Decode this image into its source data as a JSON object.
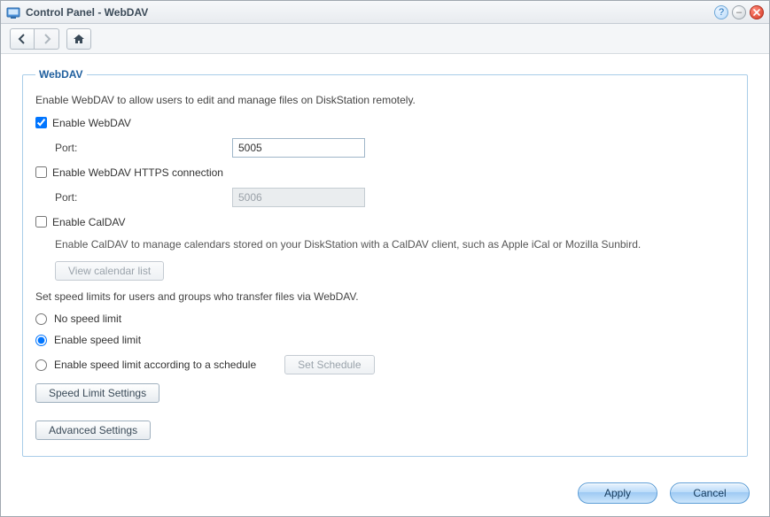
{
  "window": {
    "title": "Control Panel - WebDAV"
  },
  "section": {
    "legend": "WebDAV",
    "intro": "Enable WebDAV to allow users to edit and manage files on DiskStation remotely.",
    "enable_webdav_label": "Enable WebDAV",
    "enable_webdav_checked": true,
    "port_label": "Port:",
    "port_value": "5005",
    "enable_https_label": "Enable WebDAV HTTPS connection",
    "enable_https_checked": false,
    "https_port_label": "Port:",
    "https_port_value": "5006",
    "enable_caldav_label": "Enable CalDAV",
    "enable_caldav_checked": false,
    "caldav_desc": "Enable CalDAV to manage calendars stored on your DiskStation with a CalDAV client, such as Apple iCal or Mozilla Sunbird.",
    "view_calendar_btn": "View calendar list",
    "speed_intro": "Set speed limits for users and groups who transfer files via WebDAV.",
    "radio": {
      "none": "No speed limit",
      "enable": "Enable speed limit",
      "schedule": "Enable speed limit according to a schedule",
      "selected": "enable"
    },
    "set_schedule_btn": "Set Schedule",
    "speed_settings_btn": "Speed Limit Settings",
    "advanced_btn": "Advanced Settings"
  },
  "footer": {
    "apply": "Apply",
    "cancel": "Cancel"
  }
}
